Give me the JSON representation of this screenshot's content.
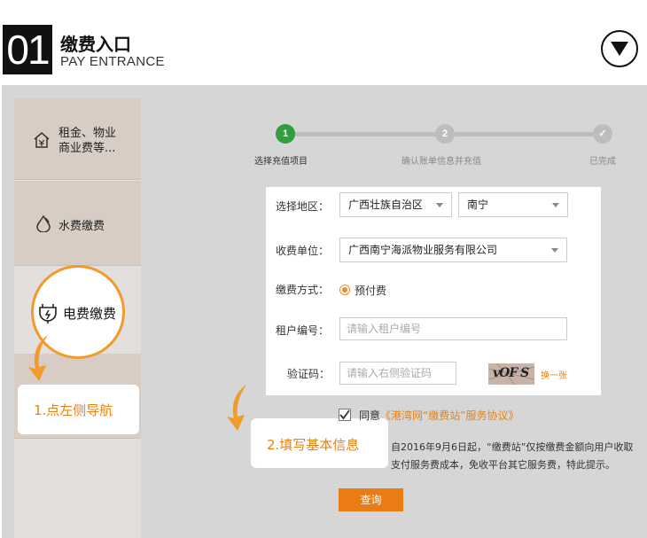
{
  "header": {
    "number": "01",
    "title": "缴费入口",
    "subtitle": "PAY ENTRANCE"
  },
  "sidebar": {
    "items": [
      {
        "label_line1": "租金、物业",
        "label_line2": "商业费等..."
      },
      {
        "label": "水费缴费"
      },
      {
        "label": "电费缴费"
      }
    ]
  },
  "tips": {
    "tip1": "1.点左侧导航",
    "tip2": "2.填写基本信息"
  },
  "steps": [
    {
      "num": "1",
      "label": "选择充值项目",
      "state": "active"
    },
    {
      "num": "2",
      "label": "确认账单信息并充值",
      "state": "pending"
    },
    {
      "num": "✓",
      "label": "已完成",
      "state": "pending"
    }
  ],
  "form": {
    "region_label": "选择地区：",
    "province_value": "广西壮族自治区",
    "city_value": "南宁",
    "unit_label": "收费单位：",
    "unit_value": "广西南宁海派物业服务有限公司",
    "method_label": "缴费方式：",
    "method_value": "预付费",
    "tenant_label": "租户编号：",
    "tenant_placeholder": "请输入租户编号",
    "captcha_label": "验证码：",
    "captcha_placeholder": "请输入右侧验证码",
    "captcha_text": "vOF S",
    "refresh_label": "换一张"
  },
  "agreement": {
    "prefix": "同意",
    "link": "《港湾网“缴费站”服务协议》"
  },
  "notice": {
    "line1": "自2016年9月6日起，“缴费站”仅按缴费金额向用户收取",
    "line2": "支付服务费成本，免收平台其它服务费，特此提示。"
  },
  "query_button": "查询",
  "colors": {
    "accent": "#f29b2b",
    "step_active": "#2e9e3e",
    "step_inactive": "#bdbdbd",
    "button": "#ea7c14"
  }
}
